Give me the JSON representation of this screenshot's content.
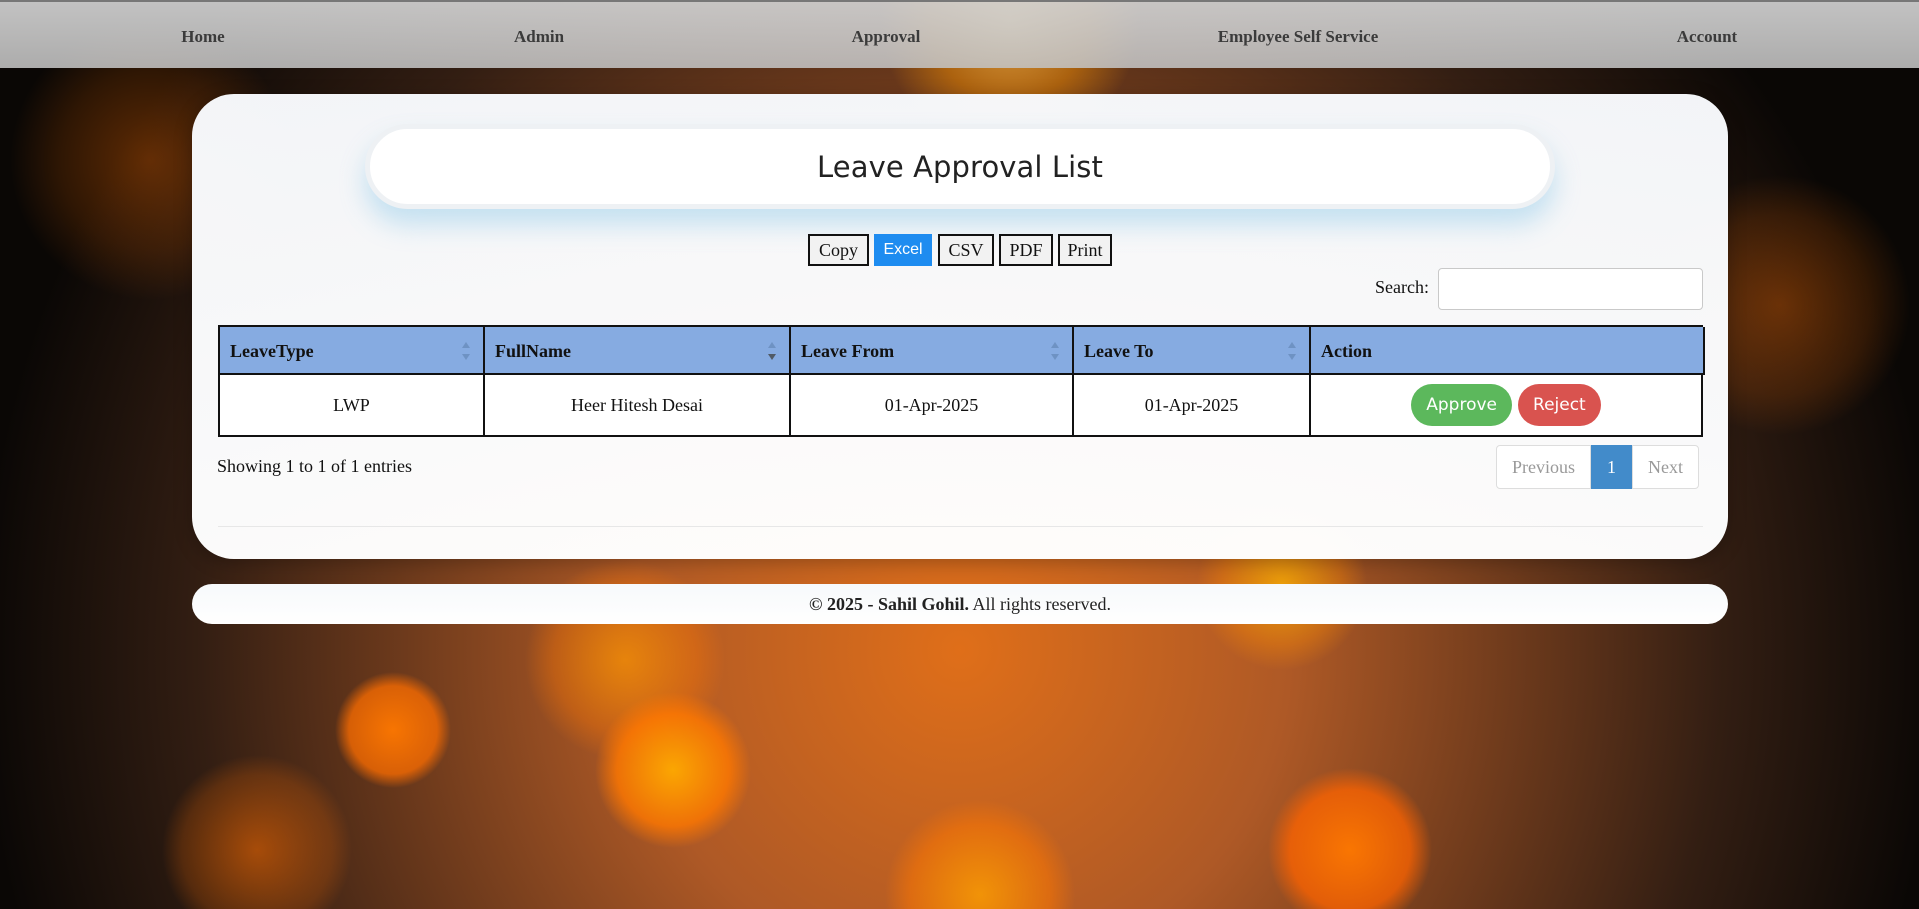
{
  "nav": {
    "items": [
      {
        "label": "Home"
      },
      {
        "label": "Admin"
      },
      {
        "label": "Approval"
      },
      {
        "label": "Employee Self Service"
      },
      {
        "label": "Account"
      }
    ]
  },
  "page": {
    "title": "Leave Approval List"
  },
  "export_buttons": [
    "Copy",
    "Excel",
    "CSV",
    "PDF",
    "Print"
  ],
  "search": {
    "label": "Search:",
    "value": "",
    "placeholder": ""
  },
  "table": {
    "headers": [
      "LeaveType",
      "FullName",
      "Leave From",
      "Leave To",
      "Action"
    ],
    "rows": [
      {
        "leave_type": "LWP",
        "full_name": "Heer Hitesh Desai",
        "leave_from": "01-Apr-2025",
        "leave_to": "01-Apr-2025",
        "approve_label": "Approve",
        "reject_label": "Reject"
      }
    ]
  },
  "pagination": {
    "info": "Showing 1 to 1 of 1 entries",
    "previous": "Previous",
    "current": "1",
    "next": "Next"
  },
  "footer": {
    "copyright": "© 2025 - ",
    "owner": "Sahil Gohil.",
    "rights": " All rights reserved."
  },
  "colors": {
    "header_blue": "#86abe1",
    "approve_green": "#5cb85c",
    "reject_red": "#d9534f",
    "active_blue": "#1e8cf0",
    "page_current": "#428bca"
  },
  "icons": {
    "sort_both": "sort-both-icon",
    "sort_desc": "sort-desc-icon"
  }
}
